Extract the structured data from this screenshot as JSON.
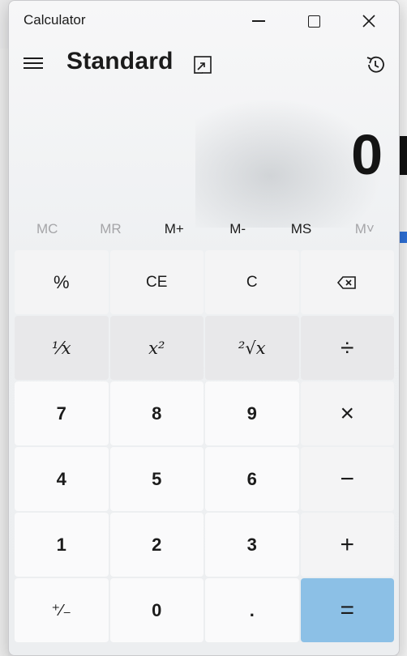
{
  "window": {
    "title": "Calculator",
    "controls": {
      "minimize": "minimize-icon",
      "maximize": "maximize-icon",
      "close": "close-icon"
    }
  },
  "header": {
    "menu_icon": "hamburger-icon",
    "mode": "Standard",
    "keep_on_top_icon": "keep-on-top-icon",
    "history_icon": "history-icon"
  },
  "display": {
    "value": "0"
  },
  "memory": {
    "mc": "MC",
    "mr": "MR",
    "mplus": "M+",
    "mminus": "M-",
    "ms": "MS",
    "mlist": "M˅"
  },
  "keys": {
    "percent": "%",
    "ce": "CE",
    "c": "C",
    "backspace_icon": "backspace-icon",
    "reciprocal": "¹⁄x",
    "square": "x²",
    "sqrt": "²√x",
    "divide": "÷",
    "seven": "7",
    "eight": "8",
    "nine": "9",
    "multiply": "×",
    "four": "4",
    "five": "5",
    "six": "6",
    "minus": "−",
    "one": "1",
    "two": "2",
    "three": "3",
    "plus": "+",
    "negate": "⁺⁄₋",
    "zero": "0",
    "decimal": ".",
    "equals": "="
  },
  "colors": {
    "equals_bg": "#8cc0e6",
    "accent": "#0067c0"
  }
}
